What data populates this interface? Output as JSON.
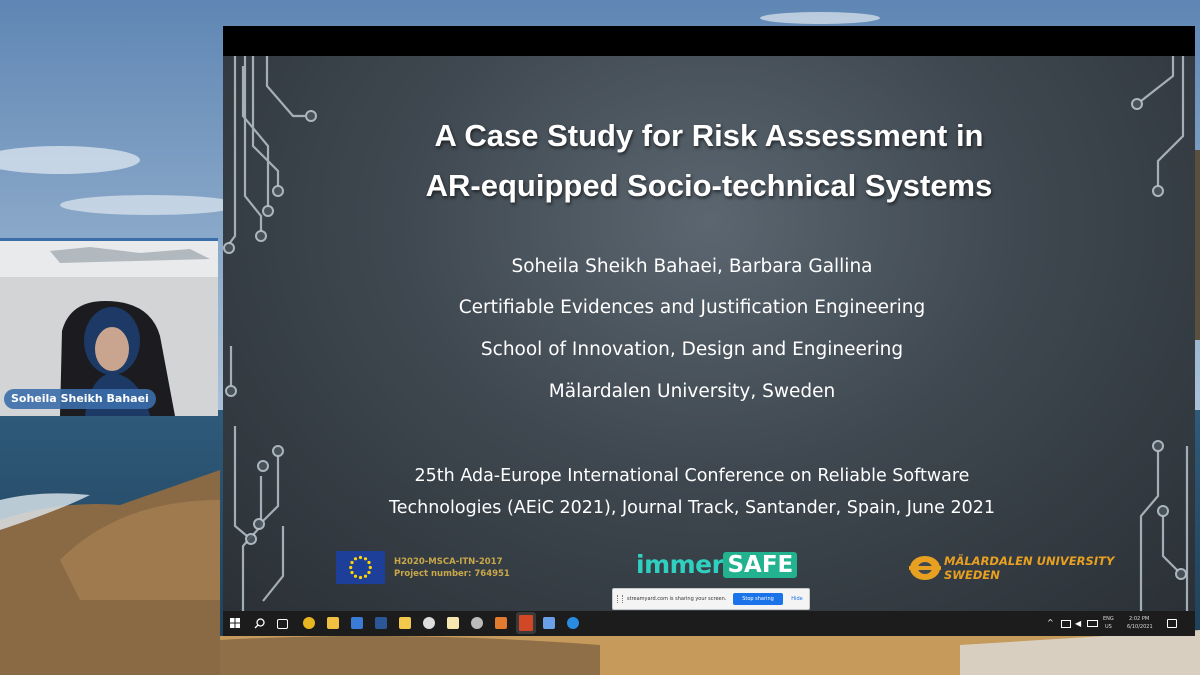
{
  "participant": {
    "name": "Soheila Sheikh Bahaei"
  },
  "slide": {
    "title_line1": "A Case Study for Risk Assessment in",
    "title_line2": "AR-equipped Socio-technical Systems",
    "authors": "Soheila Sheikh Bahaei, Barbara Gallina",
    "group": "Certifiable Evidences and Justification Engineering",
    "school": "School of Innovation, Design and Engineering",
    "university": "Mälardalen University, Sweden",
    "conference_line1": "25th Ada-Europe International Conference on Reliable Software",
    "conference_line2": "Technologies (AEiC 2021), Journal Track, Santander, Spain, June 2021",
    "eu_program": "H2020-MSCA-ITN-2017",
    "eu_project": "Project number: 764951",
    "immersafe_part1": "immer",
    "immersafe_part2": "SAFE",
    "mdh_line1": "MÄLARDALEN UNIVERSITY",
    "mdh_line2": "SWEDEN"
  },
  "share_notice": {
    "text": "streamyard.com is sharing your screen.",
    "stop_label": "Stop sharing",
    "hide_label": "Hide"
  },
  "taskbar": {
    "language": "ENG",
    "region": "US",
    "time": "2:02 PM",
    "date": "6/10/2021"
  },
  "colors": {
    "accent": "#1a73e8",
    "immersafe_teal": "#2fd0c0",
    "mdh_orange": "#e8a020",
    "eu_blue": "#1d3f99"
  }
}
